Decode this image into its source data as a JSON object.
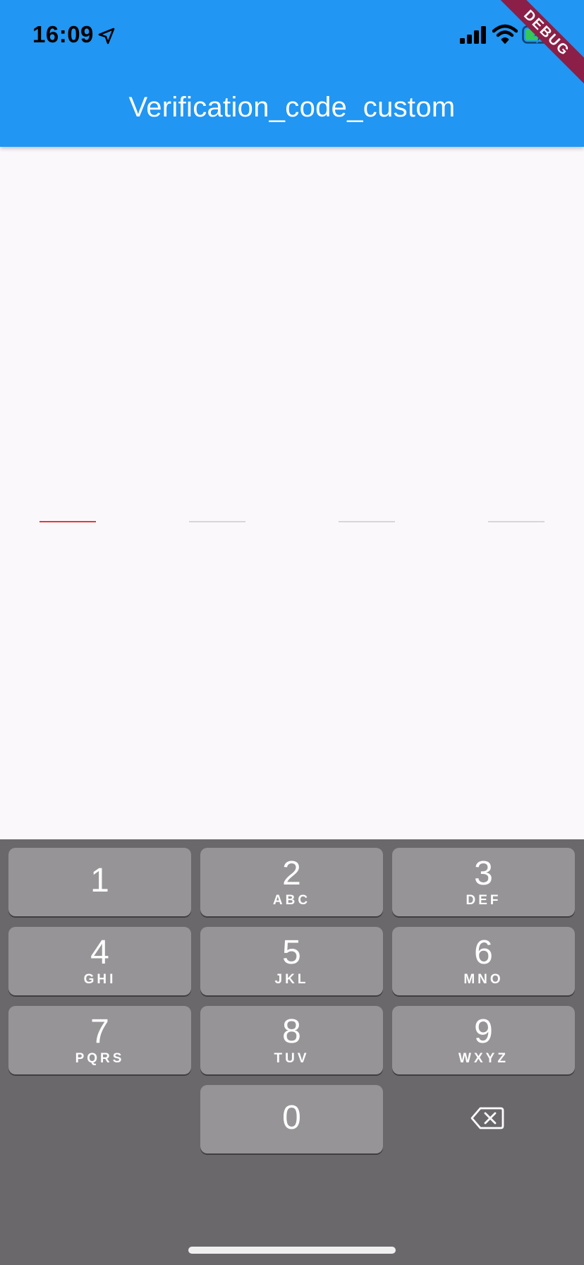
{
  "status_bar": {
    "time": "16:09",
    "icons": [
      "location-arrow-icon",
      "cellular-signal-icon",
      "wifi-icon",
      "battery-charging-icon"
    ]
  },
  "app_bar": {
    "title": "Verification_code_custom",
    "color": "#2196f3"
  },
  "debug_banner": {
    "label": "DEBUG",
    "color": "#8b1f47"
  },
  "verification": {
    "slot_count": 4,
    "active_index": 0,
    "active_color": "#e53935",
    "inactive_color": "#d8d6da"
  },
  "keypad": {
    "keys": [
      {
        "digit": "1",
        "letters": ""
      },
      {
        "digit": "2",
        "letters": "ABC"
      },
      {
        "digit": "3",
        "letters": "DEF"
      },
      {
        "digit": "4",
        "letters": "GHI"
      },
      {
        "digit": "5",
        "letters": "JKL"
      },
      {
        "digit": "6",
        "letters": "MNO"
      },
      {
        "digit": "7",
        "letters": "PQRS"
      },
      {
        "digit": "8",
        "letters": "TUV"
      },
      {
        "digit": "9",
        "letters": "WXYZ"
      },
      {
        "digit": "0",
        "letters": ""
      }
    ],
    "backspace_icon": "backspace-icon"
  }
}
